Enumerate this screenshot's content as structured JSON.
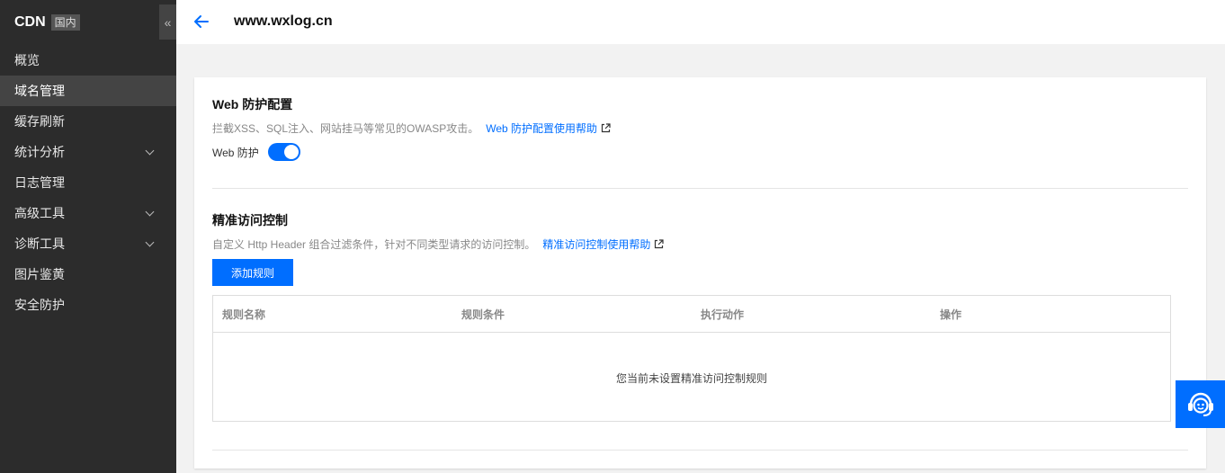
{
  "sidebar": {
    "title": "CDN",
    "badge": "国内",
    "collapse_icon": "«",
    "items": [
      {
        "label": "概览"
      },
      {
        "label": "域名管理"
      },
      {
        "label": "缓存刷新"
      },
      {
        "label": "统计分析"
      },
      {
        "label": "日志管理"
      },
      {
        "label": "高级工具"
      },
      {
        "label": "诊断工具"
      },
      {
        "label": "图片鉴黄"
      },
      {
        "label": "安全防护"
      }
    ]
  },
  "header": {
    "title": "www.wxlog.cn"
  },
  "web_protection": {
    "title": "Web 防护配置",
    "description": "拦截XSS、SQL注入、网站挂马等常见的OWASP攻击。",
    "help_link": "Web 防护配置使用帮助",
    "toggle_label": "Web 防护"
  },
  "access_control": {
    "title": "精准访问控制",
    "description": "自定义 Http Header 组合过滤条件，针对不同类型请求的访问控制。",
    "help_link": "精准访问控制使用帮助",
    "add_button": "添加规则",
    "columns": [
      "规则名称",
      "规则条件",
      "执行动作",
      "操作"
    ],
    "empty_text": "您当前未设置精准访问控制规则"
  },
  "colors": {
    "accent": "#006eff",
    "sidebar_bg": "#2c2c2c"
  }
}
